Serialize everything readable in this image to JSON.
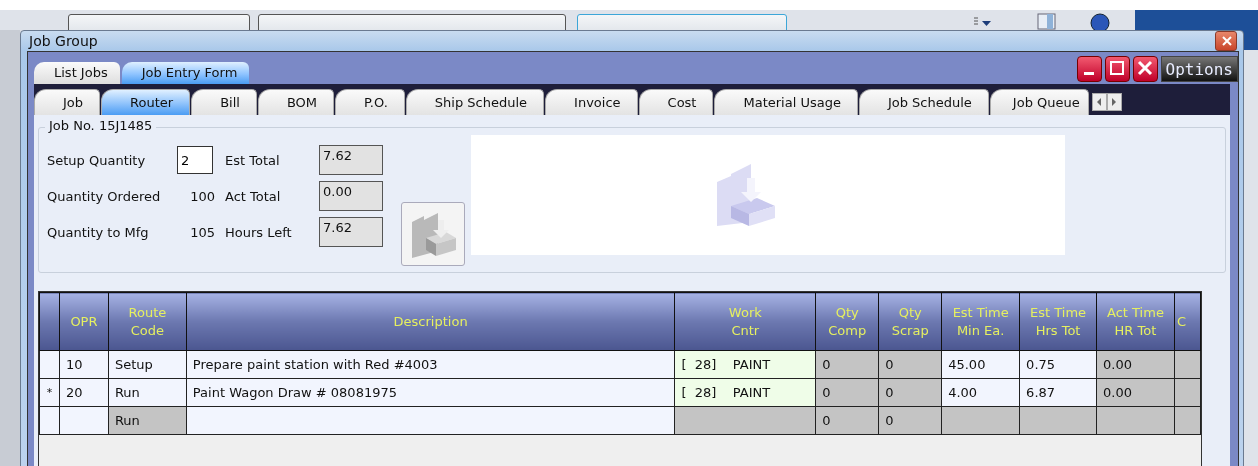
{
  "window": {
    "title": "Job Group"
  },
  "top_tabs": [
    {
      "label": "List Jobs",
      "selected": false
    },
    {
      "label": "Job Entry Form",
      "selected": true
    }
  ],
  "options_button": "Options",
  "tabs": [
    {
      "label": "Job",
      "selected": false
    },
    {
      "label": "Router",
      "selected": true
    },
    {
      "label": "Bill",
      "selected": false
    },
    {
      "label": "BOM",
      "selected": false
    },
    {
      "label": "P.O.",
      "selected": false
    },
    {
      "label": "Ship Schedule",
      "selected": false
    },
    {
      "label": "Invoice",
      "selected": false
    },
    {
      "label": "Cost",
      "selected": false
    },
    {
      "label": "Material Usage",
      "selected": false
    },
    {
      "label": "Job Schedule",
      "selected": false
    },
    {
      "label": "Job Queue",
      "selected": false
    }
  ],
  "job_group": {
    "title": "Job No. 15J1485",
    "setup_quantity": {
      "label": "Setup Quantity",
      "value": "2"
    },
    "quantity_ordered": {
      "label": "Quantity Ordered",
      "value": "100"
    },
    "quantity_to_mfg": {
      "label": "Quantity to Mfg",
      "value": "105"
    },
    "est_total": {
      "label": "Est Total",
      "value": "7.62"
    },
    "act_total": {
      "label": "Act Total",
      "value": "0.00"
    },
    "hours_left": {
      "label": "Hours Left",
      "value": "7.62"
    }
  },
  "table": {
    "columns": [
      "",
      "OPR",
      "Route\nCode",
      "Description",
      "Work\nCntr",
      "Qty\nComp",
      "Qty\nScrap",
      "Est Time\nMin Ea.",
      "Est Time\nHrs Tot",
      "Act Time\nHR Tot",
      "C"
    ],
    "rows": [
      {
        "cells": [
          {
            "text": "",
            "kind": "marker"
          },
          {
            "text": "10",
            "kind": "editable"
          },
          {
            "text": "Setup",
            "kind": "editable"
          },
          {
            "text": "Prepare paint station with Red #4003",
            "kind": "editable"
          },
          {
            "text": "[  28]    PAINT",
            "kind": "linked"
          },
          {
            "text": "0",
            "kind": "locked"
          },
          {
            "text": "0",
            "kind": "locked"
          },
          {
            "text": "45.00",
            "kind": "editable"
          },
          {
            "text": "0.75",
            "kind": "editable"
          },
          {
            "text": "0.00",
            "kind": "locked"
          },
          {
            "text": "",
            "kind": "locked"
          }
        ]
      },
      {
        "cells": [
          {
            "text": "*",
            "kind": "marker"
          },
          {
            "text": "20",
            "kind": "editable"
          },
          {
            "text": "Run",
            "kind": "editable"
          },
          {
            "text": "Paint Wagon Draw # 08081975",
            "kind": "editable"
          },
          {
            "text": "[  28]    PAINT",
            "kind": "linked"
          },
          {
            "text": "0",
            "kind": "locked"
          },
          {
            "text": "0",
            "kind": "locked"
          },
          {
            "text": "4.00",
            "kind": "editable"
          },
          {
            "text": "6.87",
            "kind": "editable"
          },
          {
            "text": "0.00",
            "kind": "locked"
          },
          {
            "text": "",
            "kind": "locked"
          }
        ]
      },
      {
        "cells": [
          {
            "text": "",
            "kind": "marker"
          },
          {
            "text": "",
            "kind": "editable"
          },
          {
            "text": "Run",
            "kind": "locked"
          },
          {
            "text": "",
            "kind": "editable"
          },
          {
            "text": "",
            "kind": "locked"
          },
          {
            "text": "0",
            "kind": "locked"
          },
          {
            "text": "0",
            "kind": "locked"
          },
          {
            "text": "",
            "kind": "locked"
          },
          {
            "text": "",
            "kind": "locked"
          },
          {
            "text": "",
            "kind": "locked"
          },
          {
            "text": "",
            "kind": "locked"
          }
        ]
      }
    ]
  }
}
